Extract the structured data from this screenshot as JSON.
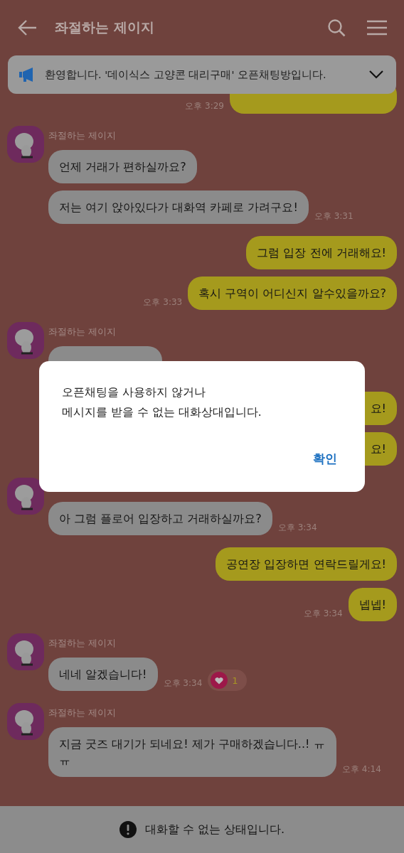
{
  "header": {
    "title": "좌절하는 제이지"
  },
  "notice": {
    "text": "환영합니다. '데이식스 고양콘 대리구매' 오픈채팅방입니다."
  },
  "messages": [
    {
      "kind": "outgoing",
      "bubbles": [
        {
          "kind": "hidden",
          "time": "오후 3:29"
        }
      ]
    },
    {
      "kind": "incoming",
      "sender": "좌절하는 제이지",
      "bubbles": [
        {
          "text": "언제 거래가 편하실까요?"
        },
        {
          "text": "저는 여기 앉아있다가 대화역 카페로 가려구요!",
          "time": "오후 3:31"
        }
      ]
    },
    {
      "kind": "outgoing",
      "bubbles": [
        {
          "text": "그럼 입장 전에 거래해요!"
        },
        {
          "text": "혹시 구역이 어디신지 알수있을까요?",
          "time": "오후 3:33"
        }
      ]
    },
    {
      "kind": "incoming",
      "sender": "좌절하는 제이지",
      "bubbles": [
        {
          "kind": "hidden"
        }
      ]
    },
    {
      "kind": "outgoing",
      "bubbles": [
        {
          "kind": "cut",
          "text": "요!"
        },
        {
          "kind": "cut",
          "text": "요!"
        }
      ]
    },
    {
      "kind": "incoming",
      "bubbles": [
        {
          "text": "아 그럼 플로어 입장하고 거래하실까요?",
          "time": "오후 3:34"
        }
      ]
    },
    {
      "kind": "outgoing",
      "bubbles": [
        {
          "text": "공연장 입장하면 연락드릴게요!"
        },
        {
          "text": "넵넵!",
          "time": "오후 3:34"
        }
      ]
    },
    {
      "kind": "incoming",
      "sender": "좌절하는 제이지",
      "bubbles": [
        {
          "text": "네네 알겠습니다!",
          "time": "오후 3:34",
          "reaction": "1"
        }
      ]
    },
    {
      "kind": "incoming",
      "sender": "좌절하는 제이지",
      "bubbles": [
        {
          "text": "지금 굿즈 대기가 되네요! 제가 구매하겠습니다..! ㅠㅠ",
          "time": "오후 4:14"
        }
      ]
    }
  ],
  "dialog": {
    "message": "오픈채팅을 사용하지 않거나\n메시지를 받을 수 없는 대화상대입니다.",
    "button": "확인"
  },
  "status_bar": {
    "text": "대화할 수 없는 상태입니다."
  }
}
